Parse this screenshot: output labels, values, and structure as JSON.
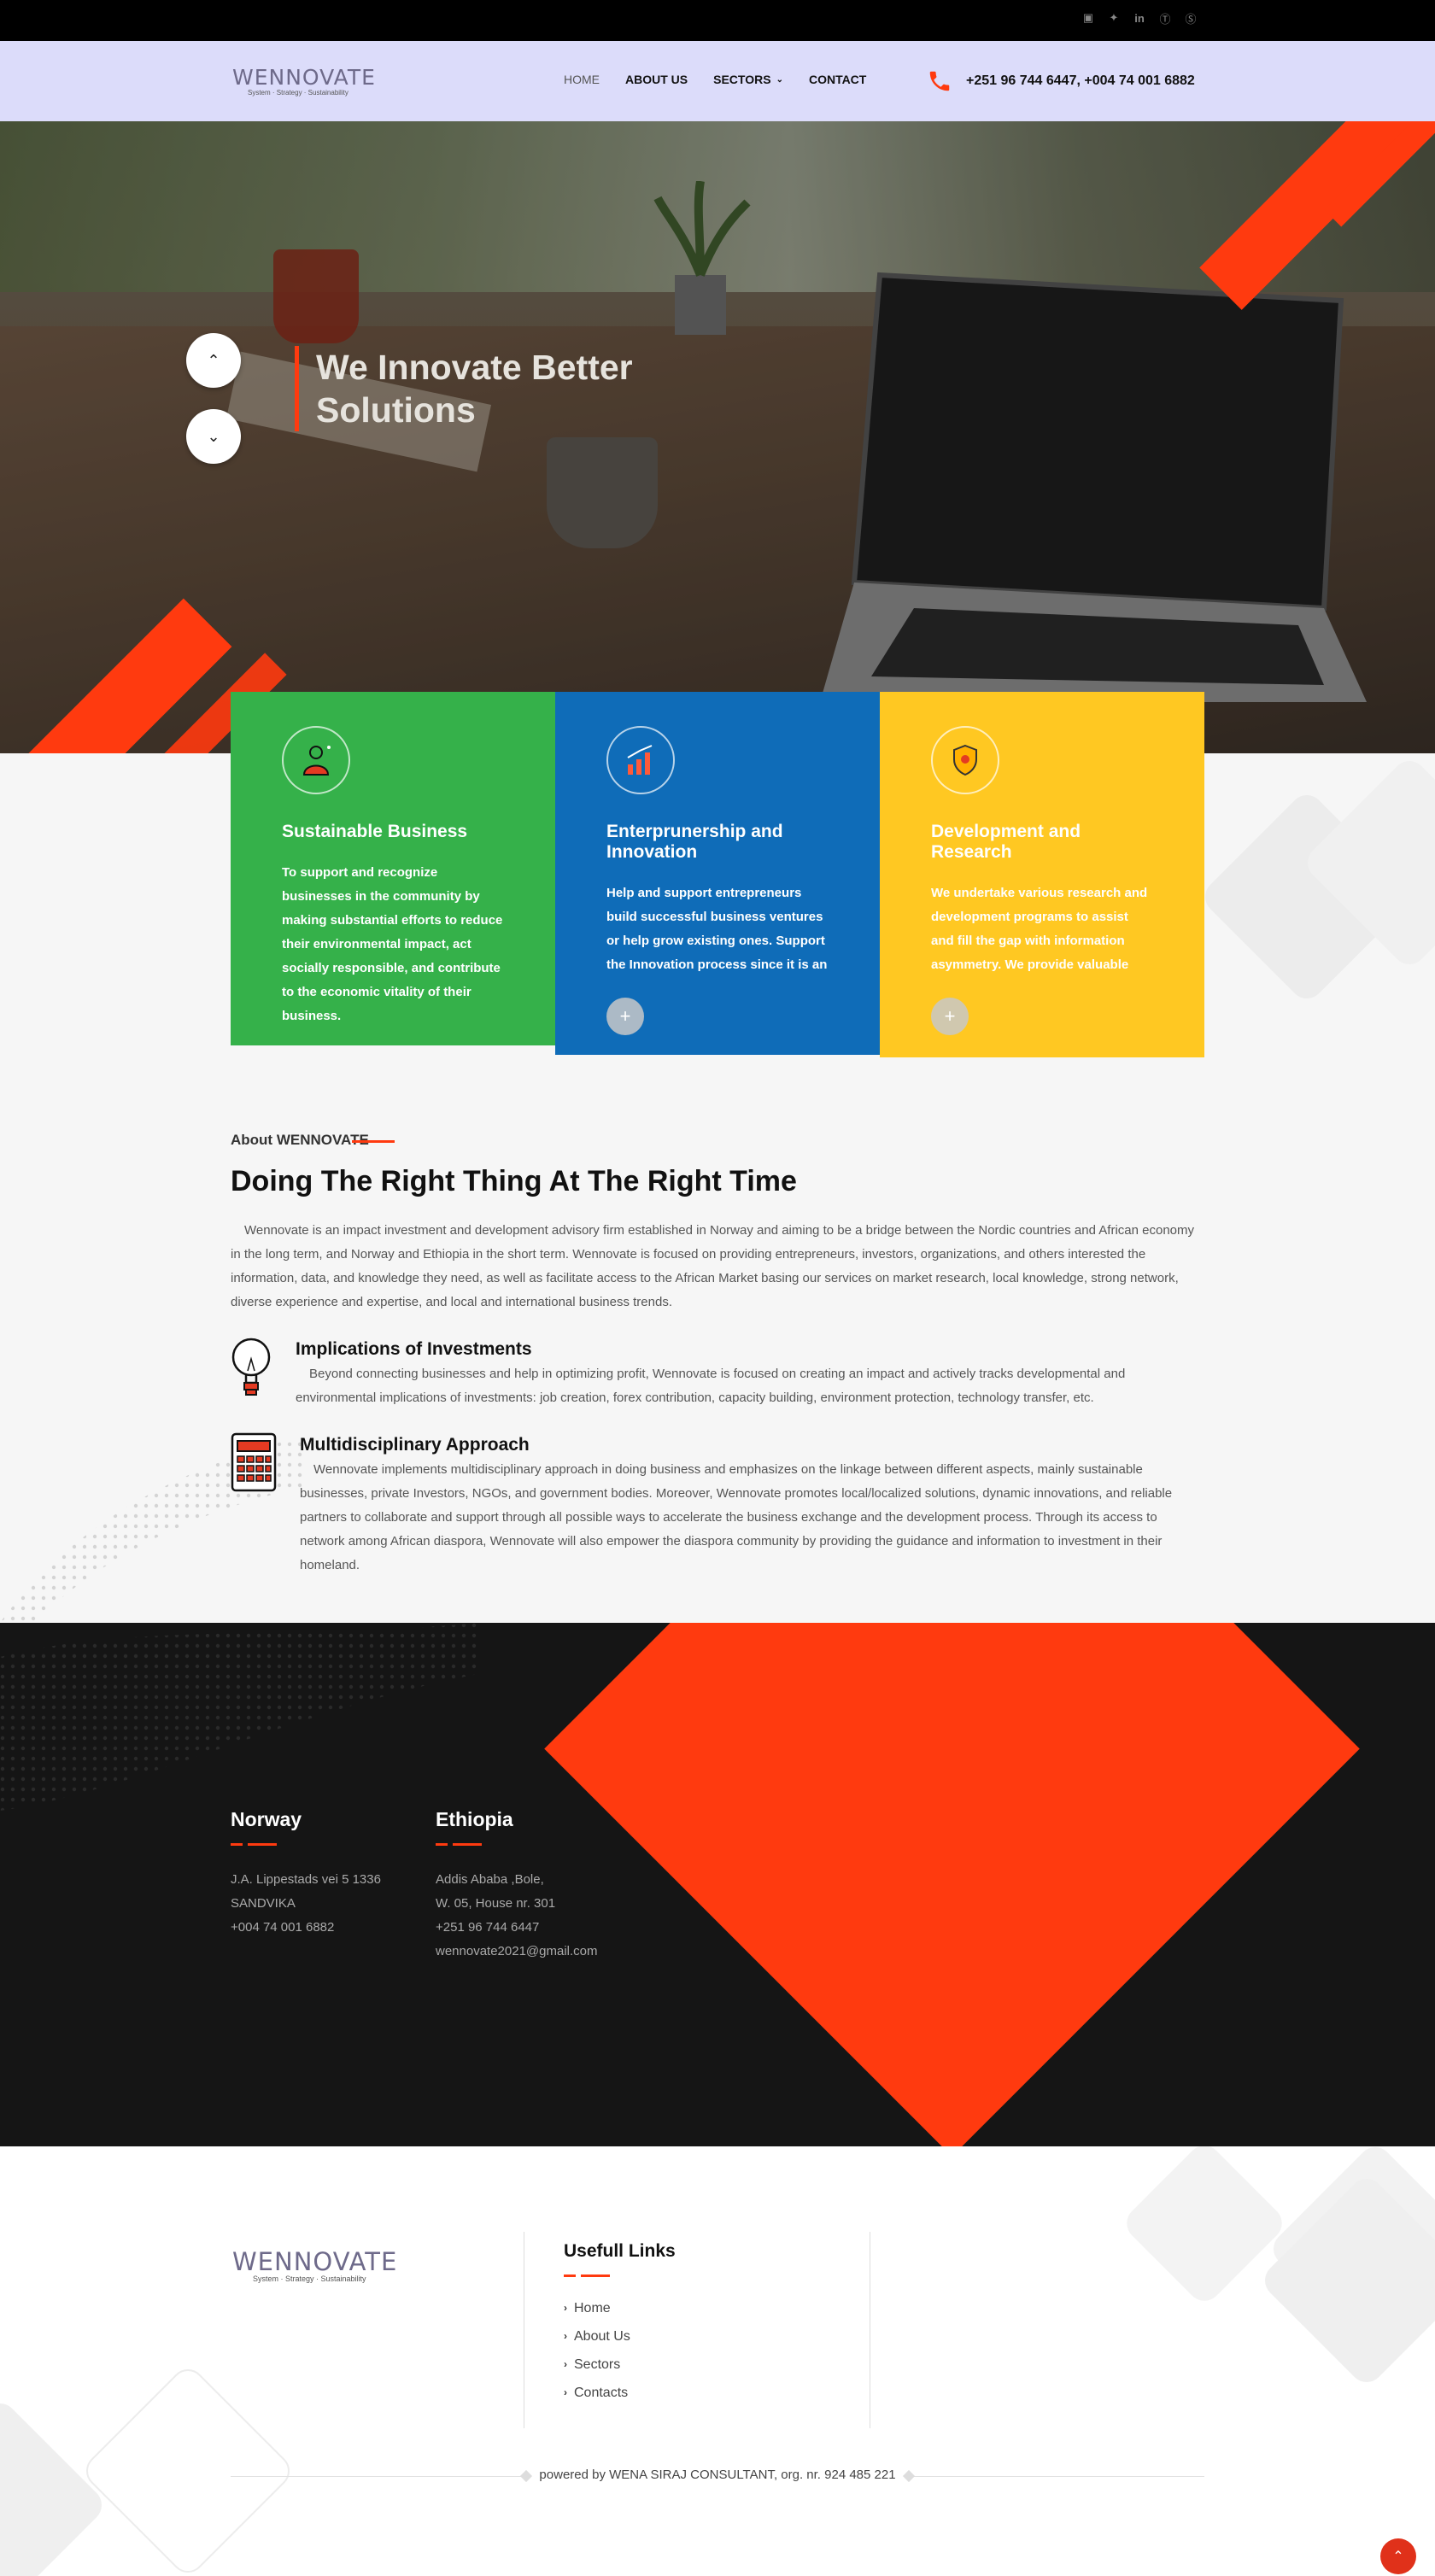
{
  "topbar": {
    "socials": [
      {
        "icon": "facebook-icon",
        "glyph": "f"
      },
      {
        "icon": "twitter-icon",
        "glyph": "t"
      },
      {
        "icon": "linkedin-icon",
        "glyph": "in"
      },
      {
        "icon": "pinterest-icon",
        "glyph": "p"
      },
      {
        "icon": "skype-icon",
        "glyph": "S"
      }
    ]
  },
  "header": {
    "logo": {
      "wordmark": "WENNOVATE",
      "tagline": "System · Strategy · Sustainability"
    },
    "nav": [
      {
        "label": "HOME"
      },
      {
        "label": "ABOUT US"
      },
      {
        "label": "SECTORS"
      },
      {
        "label": "CONTACT"
      }
    ],
    "phone": "+251 96 744 6447, +004 74 001 6882"
  },
  "hero": {
    "title": "We Innovate Better Solutions",
    "colors": {
      "accent": "#ff3a0f"
    }
  },
  "features": [
    {
      "title": "Sustainable Business",
      "text": "To support and recognize businesses in the community by making substantial efforts to reduce their environmental impact, act socially responsible, and contribute to the economic vitality of their business.",
      "icon": "person-growth-icon",
      "color": "#35b14a"
    },
    {
      "title": "Enterprunership and Innovation",
      "text": "Help and support entrepreneurs build successful business ventures or help grow existing ones. Support the Innovation process since it is an",
      "icon": "bar-chart-icon",
      "color": "#0f6cb8"
    },
    {
      "title": "Development and Research",
      "text": "We undertake various research and development programs to assist and fill the gap with information asymmetry. We provide valuable knowledge and insights, which leads to improvements in existing",
      "icon": "shield-icon",
      "color": "#ffc822"
    }
  ],
  "about": {
    "label": "About WENNOVATE",
    "heading": "Doing The Right Thing At The Right Time",
    "lead": "Wennovate is an impact investment and development advisory firm established in Norway and aiming to be a bridge between the Nordic countries and African economy in the long term, and Norway and Ethiopia in the short term. Wennovate is focused on providing entrepreneurs, investors, organizations, and others interested the information, data, and knowledge they need, as well as facilitate access to the African Market basing our services on market research, local knowledge, strong network, diverse experience and expertise, and local and international business trends.",
    "items": [
      {
        "title": "Implications of Investments",
        "text": "Beyond connecting businesses and help in optimizing profit, Wennovate is focused on creating an impact and actively tracks developmental and environmental implications of investments: job creation, forex contribution, capacity building, environment protection, technology transfer, etc.",
        "icon": "lightbulb-icon"
      },
      {
        "title": "Multidisciplinary Approach",
        "text": "Wennovate implements multidisciplinary approach in doing business and emphasizes on the linkage between different aspects, mainly sustainable businesses, private Investors, NGOs, and government bodies. Moreover, Wennovate promotes local/localized solutions, dynamic innovations, and reliable partners to collaborate and support through all possible ways to accelerate the business exchange and the development process. Through its access to network among African diaspora, Wennovate will also empower the diaspora community by providing the guidance and information to investment in their homeland.",
        "icon": "calculator-icon"
      }
    ]
  },
  "offices": [
    {
      "name": "Norway",
      "lines": [
        "J.A. Lippestads vei 5 1336",
        "SANDVIKA",
        "+004 74 001 6882"
      ]
    },
    {
      "name": "Ethiopia",
      "lines": [
        "Addis Ababa ,Bole,",
        "W. 05, House nr. 301",
        "+251 96 744 6447",
        "wennovate2021@gmail.com"
      ]
    }
  ],
  "footer": {
    "logo": {
      "wordmark": "WENNOVATE",
      "tagline": "System · Strategy · Sustainability"
    },
    "links_title": "Usefull Links",
    "links": [
      {
        "label": "Home"
      },
      {
        "label": "About Us"
      },
      {
        "label": "Sectors"
      },
      {
        "label": "Contacts"
      }
    ],
    "copyright": "powered by WENA SIRAJ CONSULTANT, org. nr. 924 485 221"
  }
}
